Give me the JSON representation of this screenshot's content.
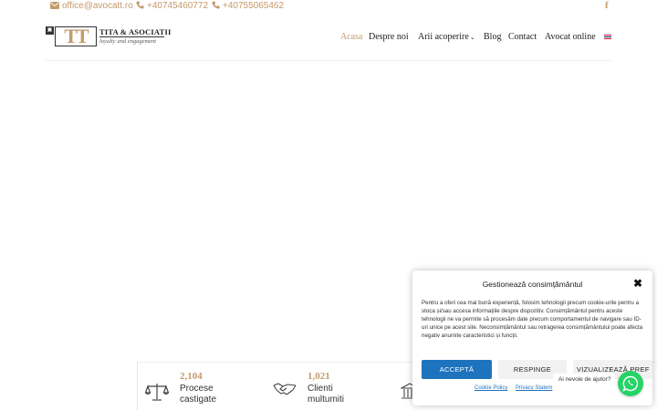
{
  "topbar": {
    "email": "office@avocatt.ro",
    "phone1": "+40745460772",
    "phone2": "+40755065462",
    "facebook": "f"
  },
  "logo": {
    "mark": "TT",
    "name": "TITA & ASOCIATII",
    "tagline": "loyalty and engagement"
  },
  "nav": {
    "items": [
      {
        "label": "Acasa"
      },
      {
        "label": "Despre noi"
      },
      {
        "label": "Arii acoperire"
      },
      {
        "label": "Blog"
      },
      {
        "label": "Contact"
      },
      {
        "label": "Avocat online"
      }
    ]
  },
  "stats": [
    {
      "number": "2,104",
      "line1": "Procese",
      "line2": "castigate"
    },
    {
      "number": "1,021",
      "line1": "Clienti",
      "line2": "multumiti"
    }
  ],
  "cookie": {
    "title": "Gestionează consimțământul",
    "body": "Pentru a oferi cea mai bună experiență, folosim tehnologii precum cookie-urile pentru a stoca și/sau accesa informațiile despre dispozitiv. Consimțământul pentru aceste tehnologii ne va permite să procesăm date precum comportamentul de navigare sau ID-uri unice pe acest site. Neconsimțământul sau retragerea consimțământului poate afecta negativ anumite caracteristici și funcții.",
    "accept": "ACCEPTĂ",
    "deny": "RESPINGE",
    "view": "VIZUALIZEAZĂ PREF",
    "cookie_policy": "Cookie Policy",
    "privacy": "Privacy Statem"
  },
  "chat": {
    "help": "Ai nevoie de ajutor?"
  },
  "colors": {
    "accent": "#c49a6c",
    "button_blue": "#1e73be",
    "whatsapp": "#25d366"
  }
}
